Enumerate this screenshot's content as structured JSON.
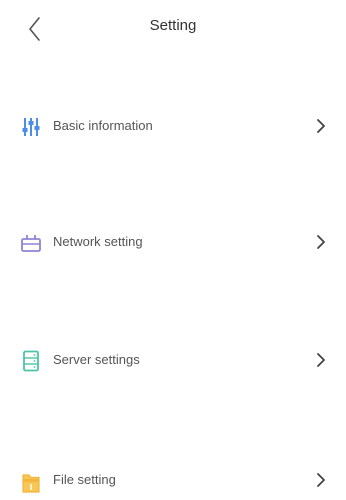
{
  "header": {
    "title": "Setting",
    "back_icon": "chevron-left-icon"
  },
  "items": [
    {
      "label": "Basic information",
      "icon": "sliders-icon",
      "color": "#4a8fe7"
    },
    {
      "label": "Network setting",
      "icon": "network-icon",
      "color": "#8e84d6"
    },
    {
      "label": "Server settings",
      "icon": "server-icon",
      "color": "#4cc4a6"
    },
    {
      "label": "File setting",
      "icon": "folder-icon",
      "color": "#f2b63c"
    }
  ]
}
